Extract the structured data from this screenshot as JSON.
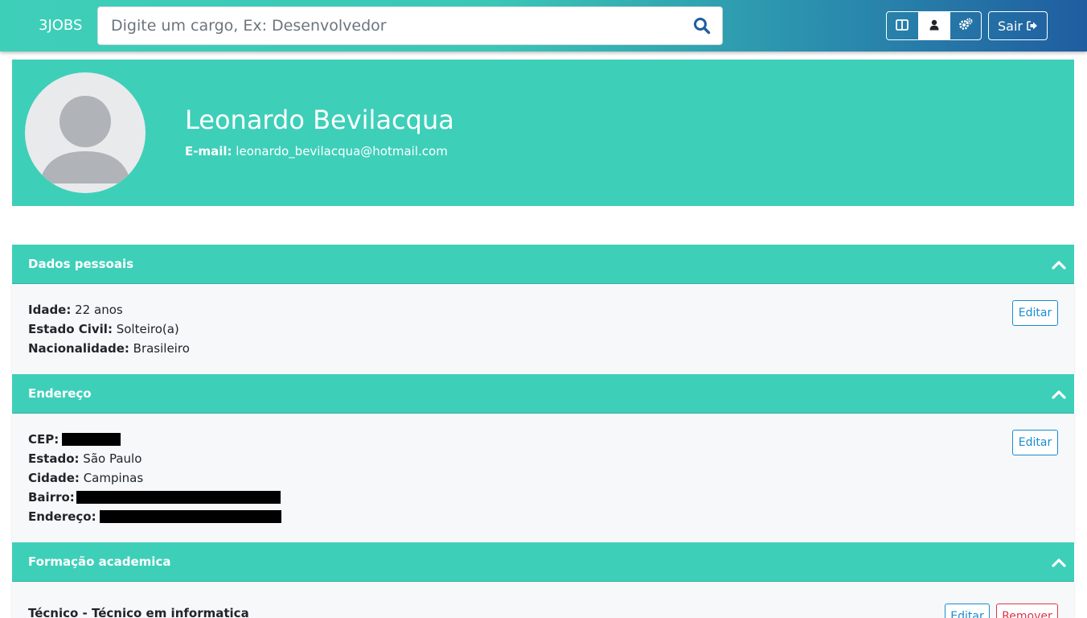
{
  "navbar": {
    "brand": "3JOBS",
    "search_placeholder": "Digite um cargo, Ex: Desenvolvedor",
    "logout_label": "Sair",
    "accent_color": "#3ecfb9",
    "icons": [
      "search-icon",
      "columns-icon",
      "user-icon",
      "cogs-icon",
      "sign-out-icon"
    ]
  },
  "profile": {
    "name": "Leonardo Bevilacqua",
    "email_label": "E-mail:",
    "email": "leonardo_bevilacqua@hotmail.com"
  },
  "sections": {
    "personal": {
      "title": "Dados pessoais",
      "edit_label": "Editar",
      "age_label": "Idade:",
      "age_value": "22 anos",
      "civil_label": "Estado Civil:",
      "civil_value": "Solteiro(a)",
      "nationality_label": "Nacionalidade:",
      "nationality_value": "Brasileiro"
    },
    "address": {
      "title": "Endereço",
      "edit_label": "Editar",
      "cep_label": "CEP:",
      "state_label": "Estado:",
      "state_value": "São Paulo",
      "city_label": "Cidade:",
      "city_value": "Campinas",
      "district_label": "Bairro:",
      "street_label": "Endereço:"
    },
    "education": {
      "title": "Formação academica",
      "edit_label": "Editar",
      "remove_label": "Remover",
      "item_title": "Técnico - Técnico em informatica"
    }
  }
}
